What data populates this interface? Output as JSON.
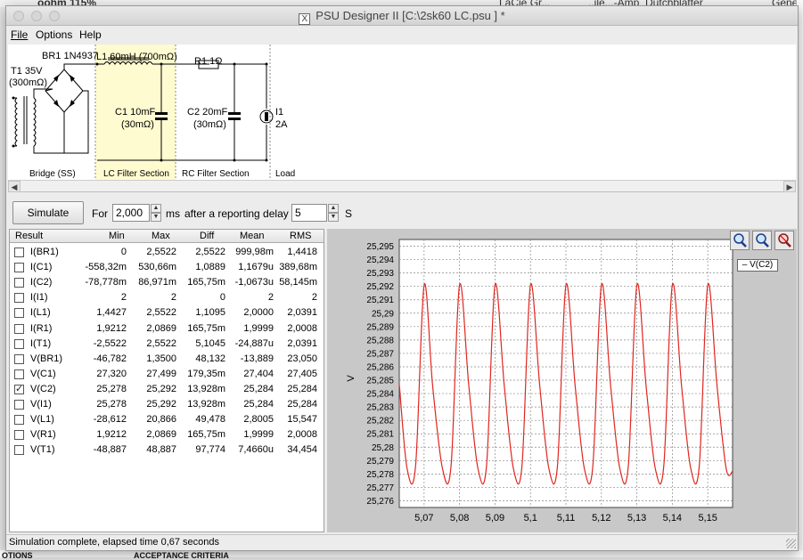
{
  "background": {
    "top_left": "oohm 115%",
    "top_mid1": "LaCie Gr...",
    "top_mid2": "..ile...-Amp_Dutchblatter",
    "top_right": "Genes",
    "bottom_left": "OTIONS",
    "bottom_mid": "ACCEPTANCE CRITERIA"
  },
  "window": {
    "title": "PSU Designer II  [C:\\2sk60 LC.psu ] *",
    "app_icon": "X"
  },
  "menu": [
    {
      "label": "File"
    },
    {
      "label": "Options"
    },
    {
      "label": "Help"
    }
  ],
  "schematic": {
    "t1_label": "T1 35V",
    "t1_res": "(300mΩ)",
    "br1_label": "BR1 1N4937",
    "l1_label": "L1 60mH (700mΩ)",
    "c1_label": "C1 10mF",
    "c1_res": "(30mΩ)",
    "r1_label": "R1 1Ω",
    "c2_label": "C2 20mF",
    "c2_res": "(30mΩ)",
    "i1_label": "I1",
    "i1_value": "2A",
    "section_bridge": "Bridge (SS)",
    "section_lc": "LC Filter Section",
    "section_rc": "RC Filter Section",
    "section_load": "Load"
  },
  "toolbar": {
    "simulate_label": "Simulate",
    "for_label": "For",
    "duration_value": "2,000",
    "ms_label": "ms",
    "delay_label": "after a reporting delay of",
    "delay_value": "5",
    "s_label": "S"
  },
  "results": {
    "headers": [
      "Result",
      "Min",
      "Max",
      "Diff",
      "Mean",
      "RMS"
    ],
    "rows": [
      {
        "name": "I(BR1)",
        "checked": false,
        "min": "0",
        "max": "2,5522",
        "diff": "2,5522",
        "mean": "999,98m",
        "rms": "1,4418"
      },
      {
        "name": "I(C1)",
        "checked": false,
        "min": "-558,32m",
        "max": "530,66m",
        "diff": "1,0889",
        "mean": "1,1679u",
        "rms": "389,68m"
      },
      {
        "name": "I(C2)",
        "checked": false,
        "min": "-78,778m",
        "max": "86,971m",
        "diff": "165,75m",
        "mean": "-1,0673u",
        "rms": "58,145m"
      },
      {
        "name": "I(I1)",
        "checked": false,
        "min": "2",
        "max": "2",
        "diff": "0",
        "mean": "2",
        "rms": "2"
      },
      {
        "name": "I(L1)",
        "checked": false,
        "min": "1,4427",
        "max": "2,5522",
        "diff": "1,1095",
        "mean": "2,0000",
        "rms": "2,0391"
      },
      {
        "name": "I(R1)",
        "checked": false,
        "min": "1,9212",
        "max": "2,0869",
        "diff": "165,75m",
        "mean": "1,9999",
        "rms": "2,0008"
      },
      {
        "name": "I(T1)",
        "checked": false,
        "min": "-2,5522",
        "max": "2,5522",
        "diff": "5,1045",
        "mean": "-24,887u",
        "rms": "2,0391"
      },
      {
        "name": "V(BR1)",
        "checked": false,
        "min": "-46,782",
        "max": "1,3500",
        "diff": "48,132",
        "mean": "-13,889",
        "rms": "23,050"
      },
      {
        "name": "V(C1)",
        "checked": false,
        "min": "27,320",
        "max": "27,499",
        "diff": "179,35m",
        "mean": "27,404",
        "rms": "27,405"
      },
      {
        "name": "V(C2)",
        "checked": true,
        "min": "25,278",
        "max": "25,292",
        "diff": "13,928m",
        "mean": "25,284",
        "rms": "25,284"
      },
      {
        "name": "V(I1)",
        "checked": false,
        "min": "25,278",
        "max": "25,292",
        "diff": "13,928m",
        "mean": "25,284",
        "rms": "25,284"
      },
      {
        "name": "V(L1)",
        "checked": false,
        "min": "-28,612",
        "max": "20,866",
        "diff": "49,478",
        "mean": "2,8005",
        "rms": "15,547"
      },
      {
        "name": "V(R1)",
        "checked": false,
        "min": "1,9212",
        "max": "2,0869",
        "diff": "165,75m",
        "mean": "1,9999",
        "rms": "2,0008"
      },
      {
        "name": "V(T1)",
        "checked": false,
        "min": "-48,887",
        "max": "48,887",
        "diff": "97,774",
        "mean": "7,4660u",
        "rms": "34,454"
      }
    ]
  },
  "plot": {
    "legend": "V(C2)",
    "zoom_buttons": [
      "zoom-in-icon",
      "zoom-out-icon",
      "zoom-reset-icon"
    ]
  },
  "chart_data": {
    "type": "line",
    "ylabel": "V",
    "xlim": [
      5.063,
      5.157
    ],
    "ylim": [
      25.2755,
      25.2955
    ],
    "x_ticks": [
      "5,07",
      "5,08",
      "5,09",
      "5,1",
      "5,11",
      "5,12",
      "5,13",
      "5,14",
      "5,15"
    ],
    "x_tick_values": [
      5.07,
      5.08,
      5.09,
      5.1,
      5.11,
      5.12,
      5.13,
      5.14,
      5.15
    ],
    "y_ticks": [
      "25,276",
      "25,277",
      "25,278",
      "25,279",
      "25,28",
      "25,281",
      "25,282",
      "25,283",
      "25,284",
      "25,285",
      "25,286",
      "25,287",
      "25,288",
      "25,289",
      "25,29",
      "25,291",
      "25,292",
      "25,293",
      "25,294",
      "25,295"
    ],
    "y_tick_values": [
      25.276,
      25.277,
      25.278,
      25.279,
      25.28,
      25.281,
      25.282,
      25.283,
      25.284,
      25.285,
      25.286,
      25.287,
      25.288,
      25.289,
      25.29,
      25.291,
      25.292,
      25.293,
      25.294,
      25.295
    ],
    "grid": true,
    "series": [
      {
        "name": "V(C2)",
        "color": "#e0261f",
        "x": [
          5.063,
          5.0652,
          5.0676,
          5.07,
          5.0724,
          5.0752,
          5.0776,
          5.08,
          5.0826,
          5.0852,
          5.0876,
          5.09,
          5.0926,
          5.0952,
          5.0976,
          5.1,
          5.1026,
          5.1052,
          5.1076,
          5.11,
          5.1126,
          5.1152,
          5.1176,
          5.12,
          5.1226,
          5.1252,
          5.1276,
          5.13,
          5.1326,
          5.1352,
          5.1376,
          5.14,
          5.1426,
          5.1452,
          5.1476,
          5.15,
          5.1526,
          5.1552,
          5.157
        ],
        "y": [
          25.2847,
          25.2784,
          25.2786,
          25.2921,
          25.2846,
          25.2784,
          25.2786,
          25.2921,
          25.2846,
          25.2784,
          25.2786,
          25.2921,
          25.2846,
          25.2784,
          25.2786,
          25.2921,
          25.2846,
          25.2784,
          25.2786,
          25.2921,
          25.2846,
          25.2784,
          25.2786,
          25.2921,
          25.2846,
          25.2784,
          25.2786,
          25.2921,
          25.2846,
          25.2784,
          25.2786,
          25.2921,
          25.2846,
          25.2784,
          25.2786,
          25.2921,
          25.2846,
          25.2784,
          25.2782
        ]
      }
    ]
  },
  "status": {
    "text": "Simulation complete, elapsed time 0,67 seconds"
  }
}
